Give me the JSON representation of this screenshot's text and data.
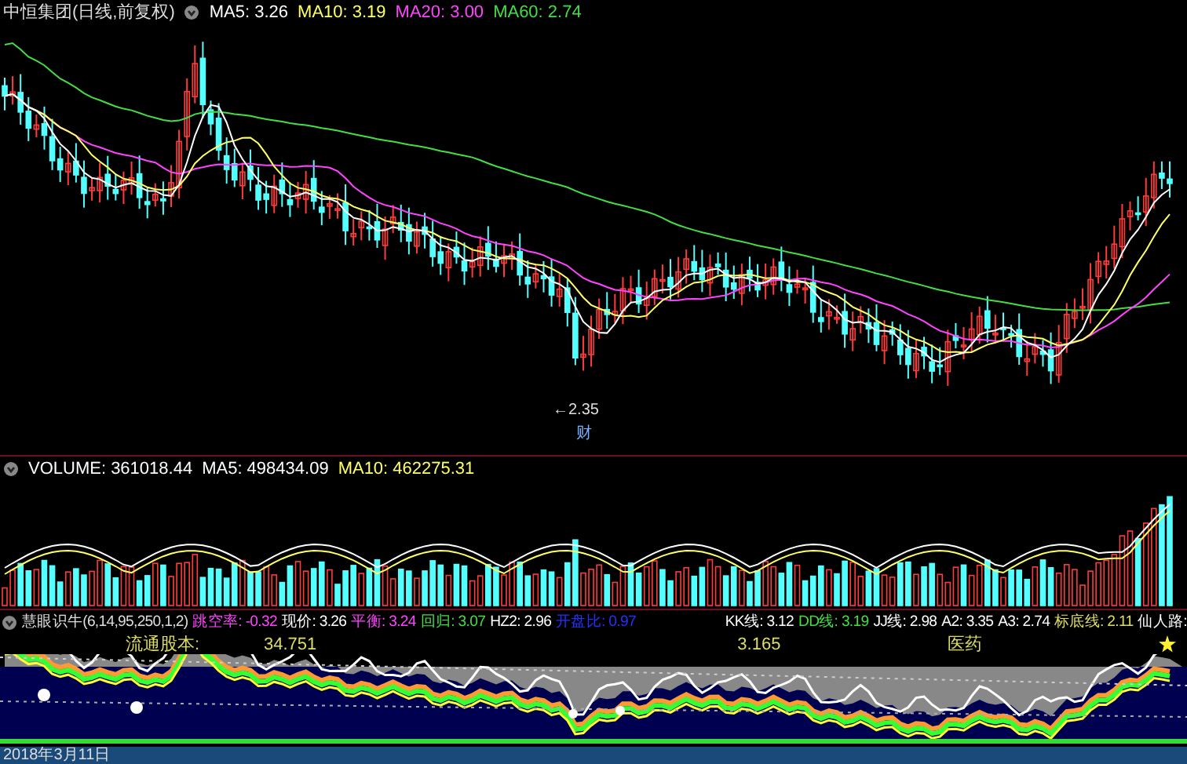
{
  "price_panel": {
    "title": "中恒集团(日线,前复权)",
    "indicators": [
      {
        "label": "MA5: 3.26",
        "color": "#ffffff"
      },
      {
        "label": "MA10: 3.19",
        "color": "#ffff66"
      },
      {
        "label": "MA20: 3.00",
        "color": "#ff44ff"
      },
      {
        "label": "MA60: 2.74",
        "color": "#44dd44"
      }
    ],
    "low_marker": "←2.35",
    "event_label": "财"
  },
  "volume_panel": {
    "indicators": [
      {
        "label": "VOLUME: 361018.44",
        "color": "#ffffff"
      },
      {
        "label": "MA5: 498434.09",
        "color": "#ffffff"
      },
      {
        "label": "MA10: 462275.31",
        "color": "#ffff66"
      }
    ]
  },
  "indicator_panel": {
    "title": "慧眼识牛(6,14,95,250,1,2)",
    "indicators": [
      {
        "label": "跳空率: -0.32",
        "color": "#ff44ff"
      },
      {
        "label": "现价: 3.26",
        "color": "#ffffff"
      },
      {
        "label": "平衡: 3.24",
        "color": "#ff44ff"
      },
      {
        "label": "回归: 3.07",
        "color": "#44dd44"
      },
      {
        "label": "HZ2: 2.96",
        "color": "#ffffff"
      },
      {
        "label": "开盘比: 0.97",
        "color": "#2233ff"
      },
      {
        "label": "KK线: 3.12",
        "color": "#ffffff"
      },
      {
        "label": "DD线: 3.19",
        "color": "#44dd44"
      },
      {
        "label": "JJ线: 2.98",
        "color": "#ffffff"
      },
      {
        "label": "A2: 3.35",
        "color": "#ffffff"
      },
      {
        "label": "A3: 2.74",
        "color": "#ffffff"
      },
      {
        "label": "标底线: 2.11",
        "color": "#dddd66"
      },
      {
        "label": "仙人路:",
        "color": "#ffffff"
      }
    ],
    "float_shares_label": "流通股本:",
    "float_shares_value": "34.751",
    "value_2": "3.165",
    "sector": "医药"
  },
  "date": "2018年3月11日"
}
